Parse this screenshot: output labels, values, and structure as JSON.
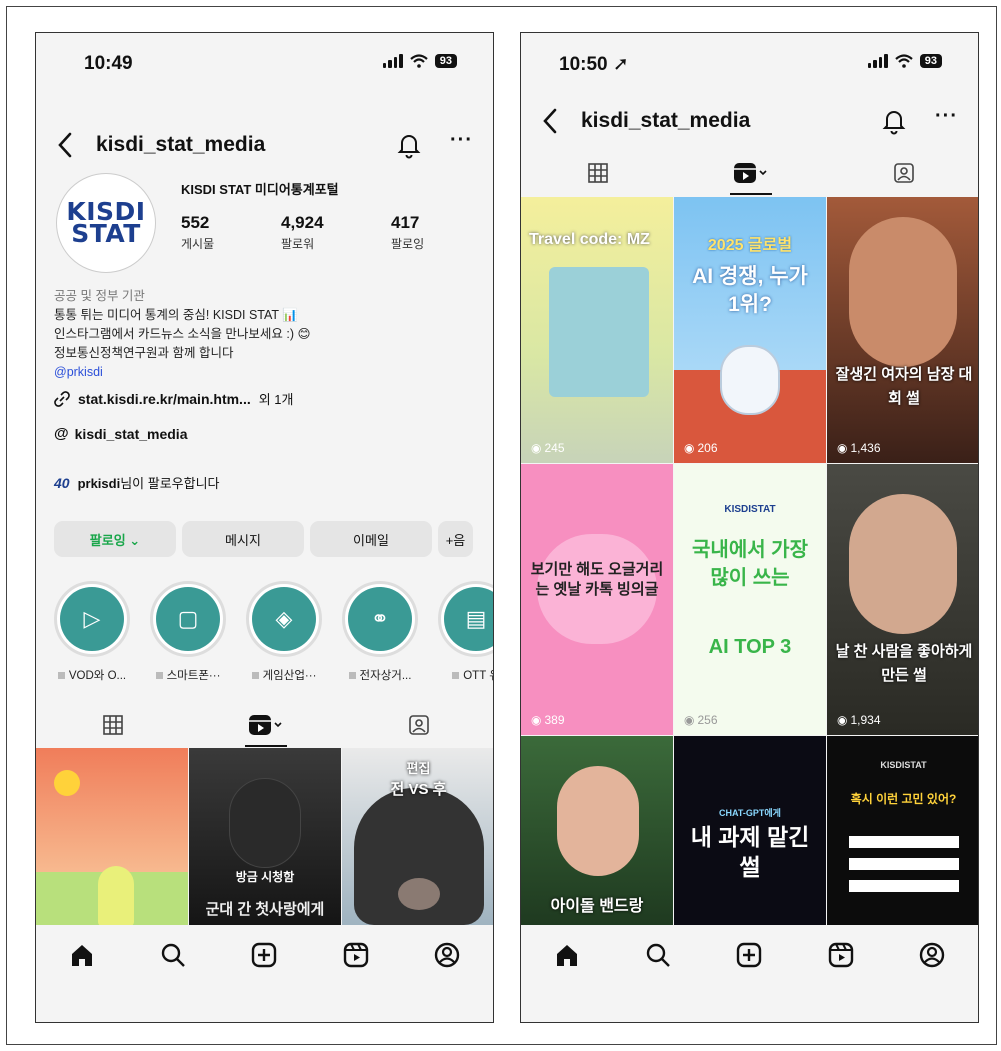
{
  "left": {
    "status": {
      "time": "10:49",
      "battery": "93"
    },
    "username": "kisdi_stat_media",
    "profile": {
      "avatar_line1": "KISDI",
      "avatar_line2": "STAT",
      "full_name": "KISDI STAT 미디어통계포털",
      "stats": [
        {
          "value": "552",
          "label": "게시물"
        },
        {
          "value": "4,924",
          "label": "팔로워"
        },
        {
          "value": "417",
          "label": "팔로잉"
        }
      ],
      "category": "공공 및 정부 기관",
      "bio_line1": "통통 튀는 미디어 통계의 중심! KISDI STAT 📊",
      "bio_line2": "인스타그램에서 카드뉴스 소식을 만나보세요 :) 😊",
      "bio_line3": "정보통신정책연구원과 함께 합니다",
      "mention": "@prkisdi",
      "link": "stat.kisdi.re.kr/main.htm...",
      "link_extra": "외 1개",
      "threads": "kisdi_stat_media",
      "followed_by_logo": "40",
      "followed_by_name": "prkisdi",
      "followed_by_suffix": "님이 팔로우합니다"
    },
    "buttons": {
      "following": "팔로잉 ⌄",
      "message": "메시지",
      "email": "이메일",
      "add": "+음"
    },
    "highlights": [
      {
        "label": "VOD와 O...",
        "icon": "▷"
      },
      {
        "label": "스마트폰···",
        "icon": "▢"
      },
      {
        "label": "게임산업···",
        "icon": "◈"
      },
      {
        "label": "전자상거...",
        "icon": "⚭"
      },
      {
        "label": "OTT 유",
        "icon": "▤"
      }
    ],
    "tiles": [
      {
        "title": "",
        "views": ""
      },
      {
        "title": "방금 시청함",
        "bottom": "군대 간 첫사랑에게",
        "views": ""
      },
      {
        "title": "전 VS 후",
        "top": "편집",
        "views": ""
      }
    ]
  },
  "right": {
    "status": {
      "time": "10:50 ➚",
      "battery": "93"
    },
    "username": "kisdi_stat_media",
    "reels": [
      {
        "title": "Travel code: MZ",
        "views": "245"
      },
      {
        "title": "2025 글로벌",
        "sub": "AI 경쟁, 누가 1위?",
        "views": "206"
      },
      {
        "title": "잘생긴 여자의 남장 대회 썰",
        "views": "1,436"
      },
      {
        "title": "보기만 해도 오글거리는 옛날 카톡 빙의글",
        "views": "389"
      },
      {
        "brand": "KISDISTAT",
        "title": "국내에서 가장 많이 쓰는",
        "sub": "AI TOP 3",
        "views": "256"
      },
      {
        "title": "날 찬 사람을 좋아하게 만든 썰",
        "views": "1,934"
      },
      {
        "title": "아이돌 밴드랑",
        "views": ""
      },
      {
        "title": "CHAT-GPT에게",
        "sub": "내 과제 맡긴 썰",
        "views": ""
      },
      {
        "brand": "KISDISTAT",
        "title": "혹시 이런 고민 있어?",
        "views": ""
      }
    ]
  },
  "colors": {
    "follow_green": "#19a64a",
    "highlight_teal": "#3a9a95",
    "mention_blue": "#2b4fd9",
    "brand_blue": "#1d3f8f"
  }
}
